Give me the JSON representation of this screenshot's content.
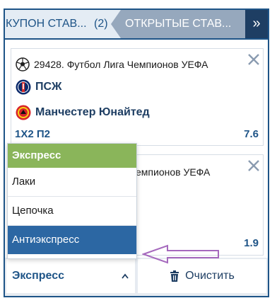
{
  "tabs": {
    "coupon_label": "КУПОН СТАВ...",
    "coupon_count": "(2)",
    "open_label": "ОТКРЫТЫЕ СТАВ...",
    "more_icon": "»"
  },
  "bets": [
    {
      "league": "29428. Футбол Лига Чемпионов УЕФА",
      "team1": "ПСЖ",
      "team2": "Манчестер Юнайтед",
      "market": "1X2 П2",
      "odds": "7.6"
    },
    {
      "league_partial": "емпионов УЕФА",
      "odds": "1.9"
    }
  ],
  "dropdown": {
    "items": [
      "Экспресс",
      "Лаки",
      "Цепочка",
      "Антиэкспресс"
    ],
    "selected_index": 0,
    "highlighted_index": 3
  },
  "bottom": {
    "bet_type_label": "Экспресс",
    "chevron": "^",
    "clear_label": "Очистить"
  },
  "colors": {
    "brand": "#1e5487",
    "selected": "#8ab55a",
    "highlight": "#2c67a3",
    "annotation_arrow": "#a569bd"
  }
}
